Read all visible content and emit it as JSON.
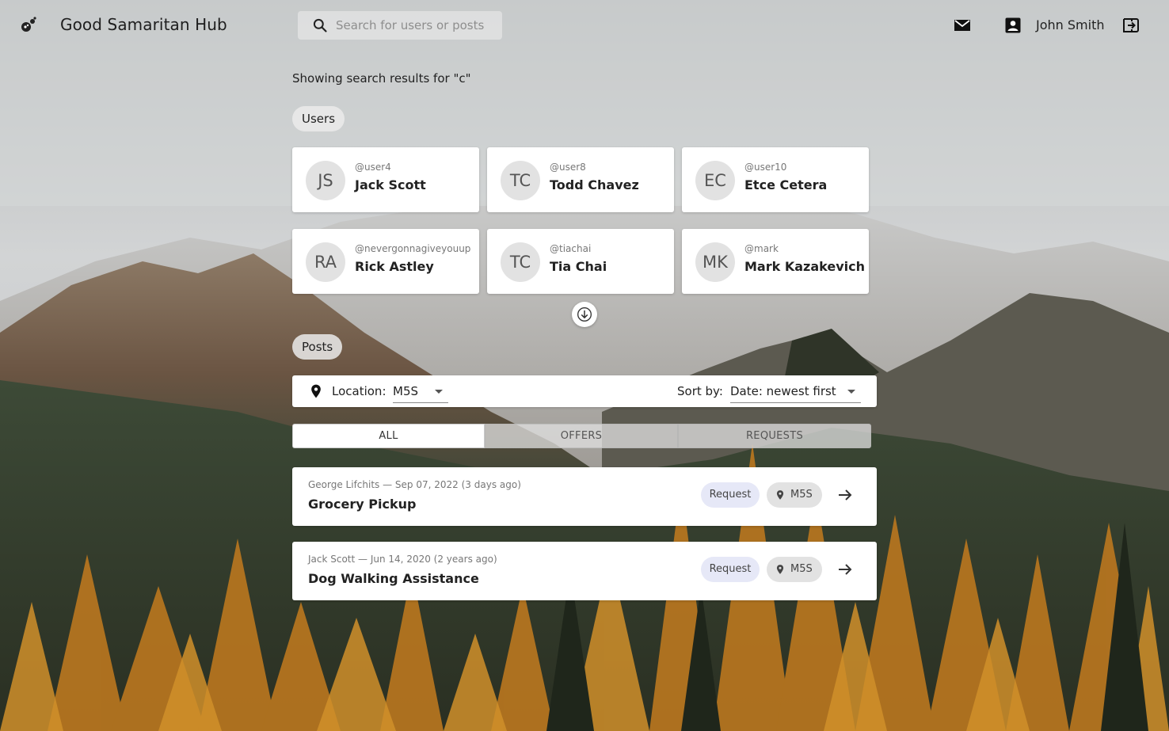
{
  "app": {
    "title": "Good Samaritan Hub"
  },
  "search": {
    "placeholder": "Search for users or posts"
  },
  "header": {
    "user_name": "John Smith"
  },
  "results": {
    "text": "Showing search results for \"c\""
  },
  "sections": {
    "users": "Users",
    "posts": "Posts"
  },
  "users": [
    {
      "initials": "JS",
      "handle": "@user4",
      "name": "Jack Scott"
    },
    {
      "initials": "TC",
      "handle": "@user8",
      "name": "Todd Chavez"
    },
    {
      "initials": "EC",
      "handle": "@user10",
      "name": "Etce Cetera"
    },
    {
      "initials": "RA",
      "handle": "@nevergonnagiveyouup",
      "name": "Rick Astley"
    },
    {
      "initials": "TC",
      "handle": "@tiachai",
      "name": "Tia Chai"
    },
    {
      "initials": "MK",
      "handle": "@mark",
      "name": "Mark Kazakevich"
    }
  ],
  "filters": {
    "location_label": "Location:",
    "location_value": "M5S",
    "sort_label": "Sort by:",
    "sort_value": "Date: newest first"
  },
  "tabs": [
    {
      "label": "ALL",
      "active": true
    },
    {
      "label": "OFFERS",
      "active": false
    },
    {
      "label": "REQUESTS",
      "active": false
    }
  ],
  "posts": [
    {
      "meta": "George Lifchits — Sep 07, 2022 (3 days ago)",
      "title": "Grocery Pickup",
      "type": "Request",
      "location": "M5S"
    },
    {
      "meta": "Jack Scott — Jun 14, 2020 (2 years ago)",
      "title": "Dog Walking Assistance",
      "type": "Request",
      "location": "M5S"
    }
  ],
  "colors": {
    "request_badge": "#e6e8f7",
    "location_badge": "#e2e2e2",
    "card": "#ffffff"
  }
}
